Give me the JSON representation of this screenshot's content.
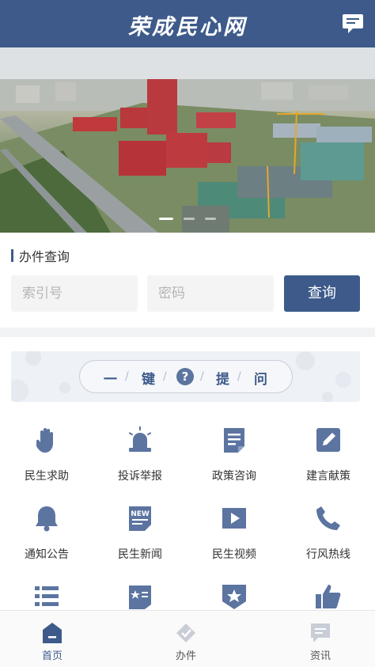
{
  "header": {
    "title": "荣成民心网"
  },
  "banner": {
    "slides": 3,
    "active_slide": 1
  },
  "query": {
    "title": "办件查询",
    "index_placeholder": "索引号",
    "password_placeholder": "密码",
    "submit_label": "查询"
  },
  "ask": {
    "chars": [
      "一",
      "键",
      "?",
      "提",
      "问"
    ]
  },
  "grid": [
    {
      "label": "民生求助",
      "icon": "hand-icon"
    },
    {
      "label": "投诉举报",
      "icon": "alarm-light-icon"
    },
    {
      "label": "政策咨询",
      "icon": "document-icon"
    },
    {
      "label": "建言献策",
      "icon": "pencil-edit-icon"
    },
    {
      "label": "通知公告",
      "icon": "bell-icon"
    },
    {
      "label": "民生新闻",
      "icon": "news-icon"
    },
    {
      "label": "民生视频",
      "icon": "video-play-icon"
    },
    {
      "label": "行风热线",
      "icon": "phone-icon"
    },
    {
      "label": "",
      "icon": "list-icon"
    },
    {
      "label": "",
      "icon": "star-badge-icon"
    },
    {
      "label": "",
      "icon": "star-shield-icon"
    },
    {
      "label": "",
      "icon": "thumbs-up-icon"
    }
  ],
  "nav": [
    {
      "label": "首页",
      "icon": "home-icon",
      "active": true
    },
    {
      "label": "办件",
      "icon": "check-diamond-icon",
      "active": false
    },
    {
      "label": "资讯",
      "icon": "chat-icon",
      "active": false
    }
  ],
  "colors": {
    "primary": "#3d5a8a",
    "icon_blue": "#5c74a0",
    "divider": "#f2f3f5"
  }
}
